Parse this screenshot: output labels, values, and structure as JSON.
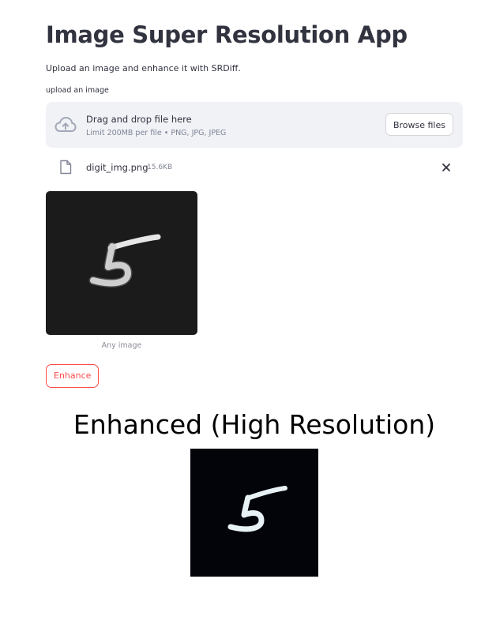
{
  "page": {
    "title": "Image Super Resolution App",
    "subtitle": "Upload an image and enhance it with SRDiff."
  },
  "uploader": {
    "label": "upload an image",
    "dropzone_title": "Drag and drop file here",
    "dropzone_limit": "Limit 200MB per file • PNG, JPG, JPEG",
    "browse_label": "Browse files",
    "icon": "cloud-upload-icon",
    "file": {
      "name": "digit_img.png",
      "size": "15.6KB",
      "icon": "file-icon",
      "remove_icon": "close-icon"
    }
  },
  "preview": {
    "caption": "Any image"
  },
  "actions": {
    "enhance_label": "Enhance"
  },
  "result": {
    "title": "Enhanced (High Resolution)"
  },
  "colors": {
    "accent": "#ff4b4b",
    "dropzone_bg": "#f0f2f6",
    "text": "#31333f",
    "muted": "#808495",
    "input_image_bg": "#1b1b1b",
    "output_image_bg": "#02040a"
  }
}
